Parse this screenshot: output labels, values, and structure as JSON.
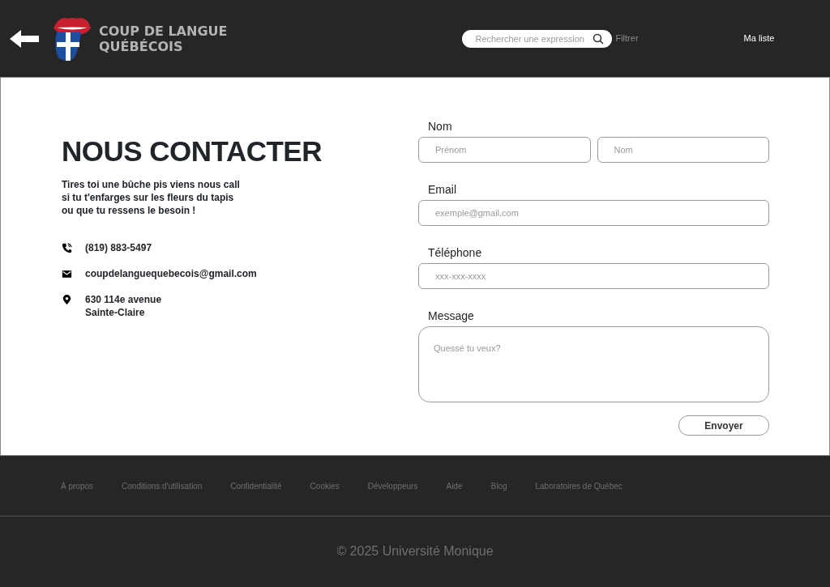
{
  "header": {
    "logo_text": "COUP DE LANGUE\nQUÉBÉCOIS",
    "search": {
      "placeholder": "Rechercher une expression"
    },
    "filter": "Filtrer",
    "nav_link": "Ma liste"
  },
  "contact": {
    "title": "NOUS CONTACTER",
    "intro": "Tires toi une bûche pis viens nous call\nsi tu t'enfarges sur les fleurs du tapis\nou que tu ressens le besoin !",
    "items": [
      {
        "kind": "phone",
        "text": "(819) 883-5497"
      },
      {
        "kind": "email",
        "text": "coupdelanguequebecois@gmail.com"
      },
      {
        "kind": "location",
        "text": "630 114e avenue\nSainte-Claire"
      }
    ]
  },
  "form": {
    "groups": [
      {
        "label": "Nom",
        "kind": "input",
        "fields": [
          {
            "placeholder": "Prénom"
          },
          {
            "placeholder": "Nom"
          }
        ]
      },
      {
        "label": "Email",
        "kind": "input",
        "fields": [
          {
            "placeholder": "exemple@gmail.com"
          }
        ]
      },
      {
        "label": "Téléphone",
        "kind": "input",
        "fields": [
          {
            "placeholder": "xxx-xxx-xxxx"
          }
        ]
      },
      {
        "label": "Message",
        "kind": "textarea",
        "fields": [
          {
            "placeholder": "Quessé tu veux?"
          }
        ]
      }
    ],
    "submit": "Envoyer"
  },
  "footer": {
    "links": [
      "À propos",
      "Conditions d'utilisation",
      "Confidentialité",
      "Cookies",
      "Développeurs",
      "Aide",
      "Blog",
      "Laboratoires de Québec"
    ],
    "copyright": "© 2025 Université Monique"
  }
}
